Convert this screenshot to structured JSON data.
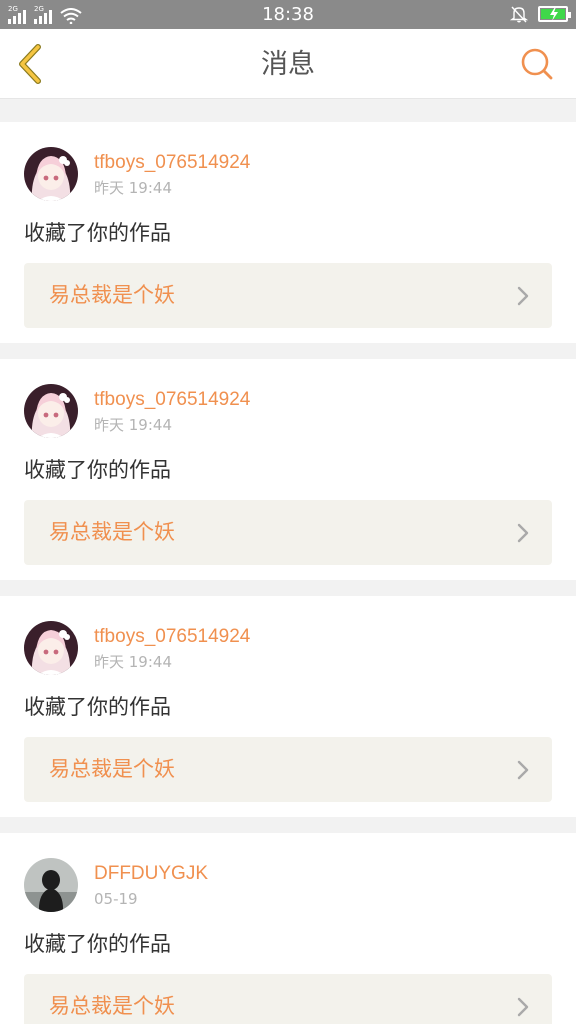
{
  "status_bar": {
    "time": "18:38",
    "sim1_tag": "2G",
    "sim2_tag": "2G",
    "battery_color": "#3fd84a"
  },
  "header": {
    "title": "消息",
    "back_icon": "chevron-left-icon",
    "search_icon": "search-icon",
    "accent_color": "#f0904f"
  },
  "messages": [
    {
      "username": "tfboys_076514924",
      "time": "昨天 19:44",
      "action": "收藏了你的作品",
      "work_title": "易总裁是个妖",
      "avatar": "anime-girl"
    },
    {
      "username": "tfboys_076514924",
      "time": "昨天 19:44",
      "action": "收藏了你的作品",
      "work_title": "易总裁是个妖",
      "avatar": "anime-girl"
    },
    {
      "username": "tfboys_076514924",
      "time": "昨天 19:44",
      "action": "收藏了你的作品",
      "work_title": "易总裁是个妖",
      "avatar": "anime-girl"
    },
    {
      "username": "DFFDUYGJK",
      "time": "05-19",
      "action": "收藏了你的作品",
      "work_title": "易总裁是个妖",
      "avatar": "dark-silhouette"
    }
  ]
}
